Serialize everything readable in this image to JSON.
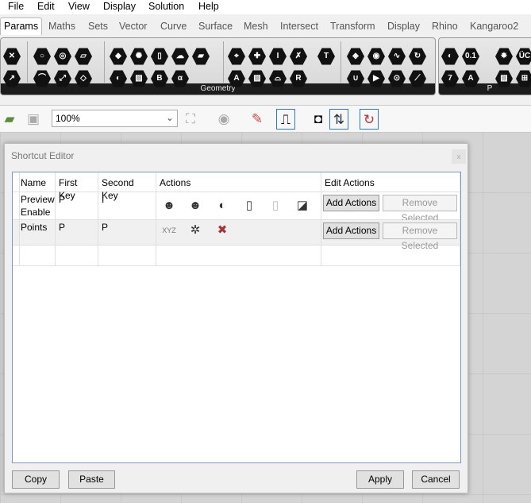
{
  "menu": [
    "File",
    "Edit",
    "View",
    "Display",
    "Solution",
    "Help"
  ],
  "tabs": [
    "Params",
    "Maths",
    "Sets",
    "Vector",
    "Curve",
    "Surface",
    "Mesh",
    "Intersect",
    "Transform",
    "Display",
    "Rhino",
    "Kangaroo2"
  ],
  "ribbon": {
    "panel_label": "Geometry",
    "panel2_label": "P"
  },
  "toolbar": {
    "zoom_value": "100%"
  },
  "dialog": {
    "title": "Shortcut Editor",
    "close": "x",
    "columns": [
      "Name",
      "First Key",
      "Second Key",
      "Actions",
      "Edit Actions"
    ],
    "rows": [
      {
        "name": "Preview Enable",
        "first_key": "P",
        "second_key": "I",
        "actions": [
          "preview-on-icon",
          "preview-off-icon",
          "preview-selected-icon",
          "enable-icon",
          "disable-icon",
          "toggle-icon"
        ]
      },
      {
        "name": "Points",
        "first_key": "P",
        "second_key": "P",
        "actions": [
          "xyz-point-icon",
          "points-icon",
          "delete-points-icon"
        ]
      }
    ],
    "add_label": "Add Actions",
    "remove_label": "Remove Selected",
    "copy": "Copy",
    "paste": "Paste",
    "apply": "Apply",
    "cancel": "Cancel"
  }
}
